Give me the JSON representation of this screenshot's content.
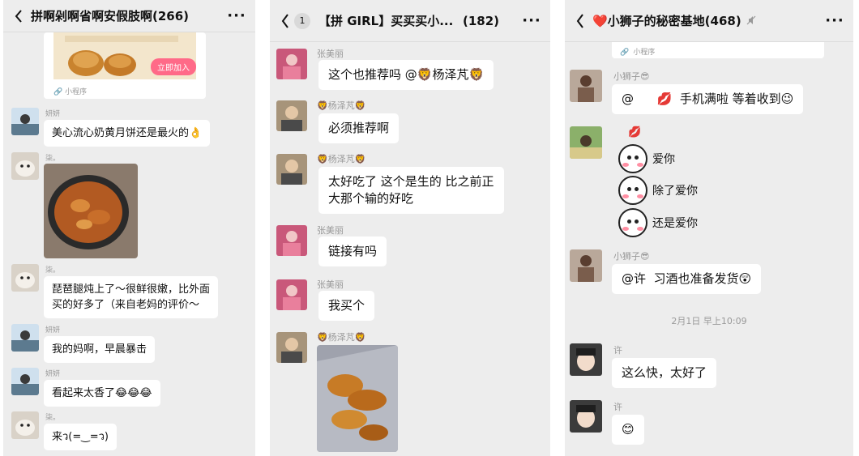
{
  "panels": [
    {
      "title": "拼啊剁啊省啊安假肢啊(266)",
      "mini_program": {
        "button": "立即加入",
        "label": "小程序"
      },
      "messages": [
        {
          "sender": "妍妍",
          "text": "美心流心奶黄月饼还是最火的👌"
        },
        {
          "sender": "柒。",
          "text": ""
        },
        {
          "sender": "柒。",
          "text_line1": "琵琶腿炖上了～很鲜很嫩，比外面",
          "text_line2": "买的好多了（来自老妈的评价～"
        },
        {
          "sender": "妍妍",
          "text": "我的妈啊，早晨暴击"
        },
        {
          "sender": "妍妍",
          "text": "看起来太香了😂😂😂"
        },
        {
          "sender": "柒。",
          "text": "来ว(=‿=ว)"
        }
      ]
    },
    {
      "title": "【拼 GIRL】买买买小...",
      "count": "(182)",
      "unread_badge": "1",
      "messages": [
        {
          "sender": "张美丽",
          "text": "这个也推荐吗 @🦁杨泽芃🦁"
        },
        {
          "sender": "🦁杨泽芃🦁",
          "text": "必须推荐啊"
        },
        {
          "sender": "🦁杨泽芃🦁",
          "text_line1": "太好吃了 这个是生的 比之前正",
          "text_line2": "大那个输的好吃"
        },
        {
          "sender": "张美丽",
          "text": "链接有吗"
        },
        {
          "sender": "张美丽",
          "text": "我买个"
        },
        {
          "sender": "🦁杨泽芃🦁",
          "text": ""
        }
      ]
    },
    {
      "title": "❤️小狮子的秘密基地(468)",
      "mini_program_label": "小程序",
      "messages": [
        {
          "sender": "小狮子😎",
          "text": "@      💋  手机满啦 等着收到😉"
        },
        {
          "sender": "",
          "stickers": [
            "爱你",
            "除了爱你",
            "还是爱你"
          ],
          "kiss": "💋"
        },
        {
          "sender": "小狮子😎",
          "text": "@许  习酒也准备发货😲"
        },
        {
          "sender": "许",
          "text": "这么快，太好了"
        },
        {
          "sender": "许",
          "text": "😊"
        }
      ],
      "timestamp": "2月1日 早上10:09"
    }
  ]
}
